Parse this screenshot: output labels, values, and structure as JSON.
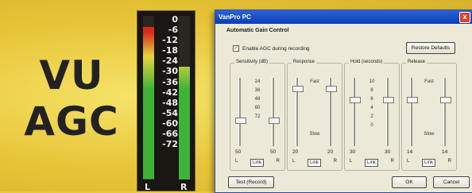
{
  "hero": {
    "line1": "VU",
    "line2": "AGC"
  },
  "meter": {
    "ticks": [
      "0",
      "-6",
      "-12",
      "-18",
      "-24",
      "-30",
      "-36",
      "-42",
      "-48",
      "-54",
      "-60",
      "-66",
      "-72"
    ],
    "left_label": "L",
    "right_label": "R",
    "left_level": 0.93,
    "right_level": 0.69,
    "colors": {
      "high": "#d62a1e",
      "mid": "#e6d43c",
      "low": "#3fb23a"
    }
  },
  "dialog": {
    "title": "VanPro PC",
    "close_glyph": "x",
    "section": "Automatic Gain Control",
    "enable_label": "Enable AGC during recording",
    "enable_checked": "✓",
    "restore_label": "Restore Defaults",
    "test_label": "Test (Record)",
    "ok_label": "OK",
    "cancel_label": "Cancel",
    "groups": [
      {
        "title": "Sensitivity (dB)",
        "scale": [
          "24",
          "36",
          "48",
          "60",
          "72"
        ],
        "left_value": "50",
        "right_value": "50",
        "l": "L",
        "link": "Link",
        "r": "R",
        "left_level": 0.62,
        "right_level": 0.62
      },
      {
        "title": "Response",
        "scale": [
          "Fast",
          "",
          "",
          "",
          "",
          "",
          "Slow"
        ],
        "left_value": "20",
        "right_value": "20",
        "l": "L",
        "link": "Link",
        "r": "R",
        "left_level": 0.12,
        "right_level": 0.12
      },
      {
        "title": "Hold (seconds)",
        "scale": [
          "10",
          "8",
          "6",
          "4",
          "2",
          "0"
        ],
        "left_value": "30",
        "right_value": "30",
        "l": "L",
        "link": "Link",
        "r": "R",
        "left_level": 0.3,
        "right_level": 0.3
      },
      {
        "title": "Release",
        "scale": [
          "Fast",
          "",
          "",
          "",
          "",
          "",
          "Slow"
        ],
        "left_value": "14",
        "right_value": "14",
        "l": "L",
        "link": "Link",
        "r": "R",
        "left_level": 0.3,
        "right_level": 0.3
      }
    ]
  }
}
